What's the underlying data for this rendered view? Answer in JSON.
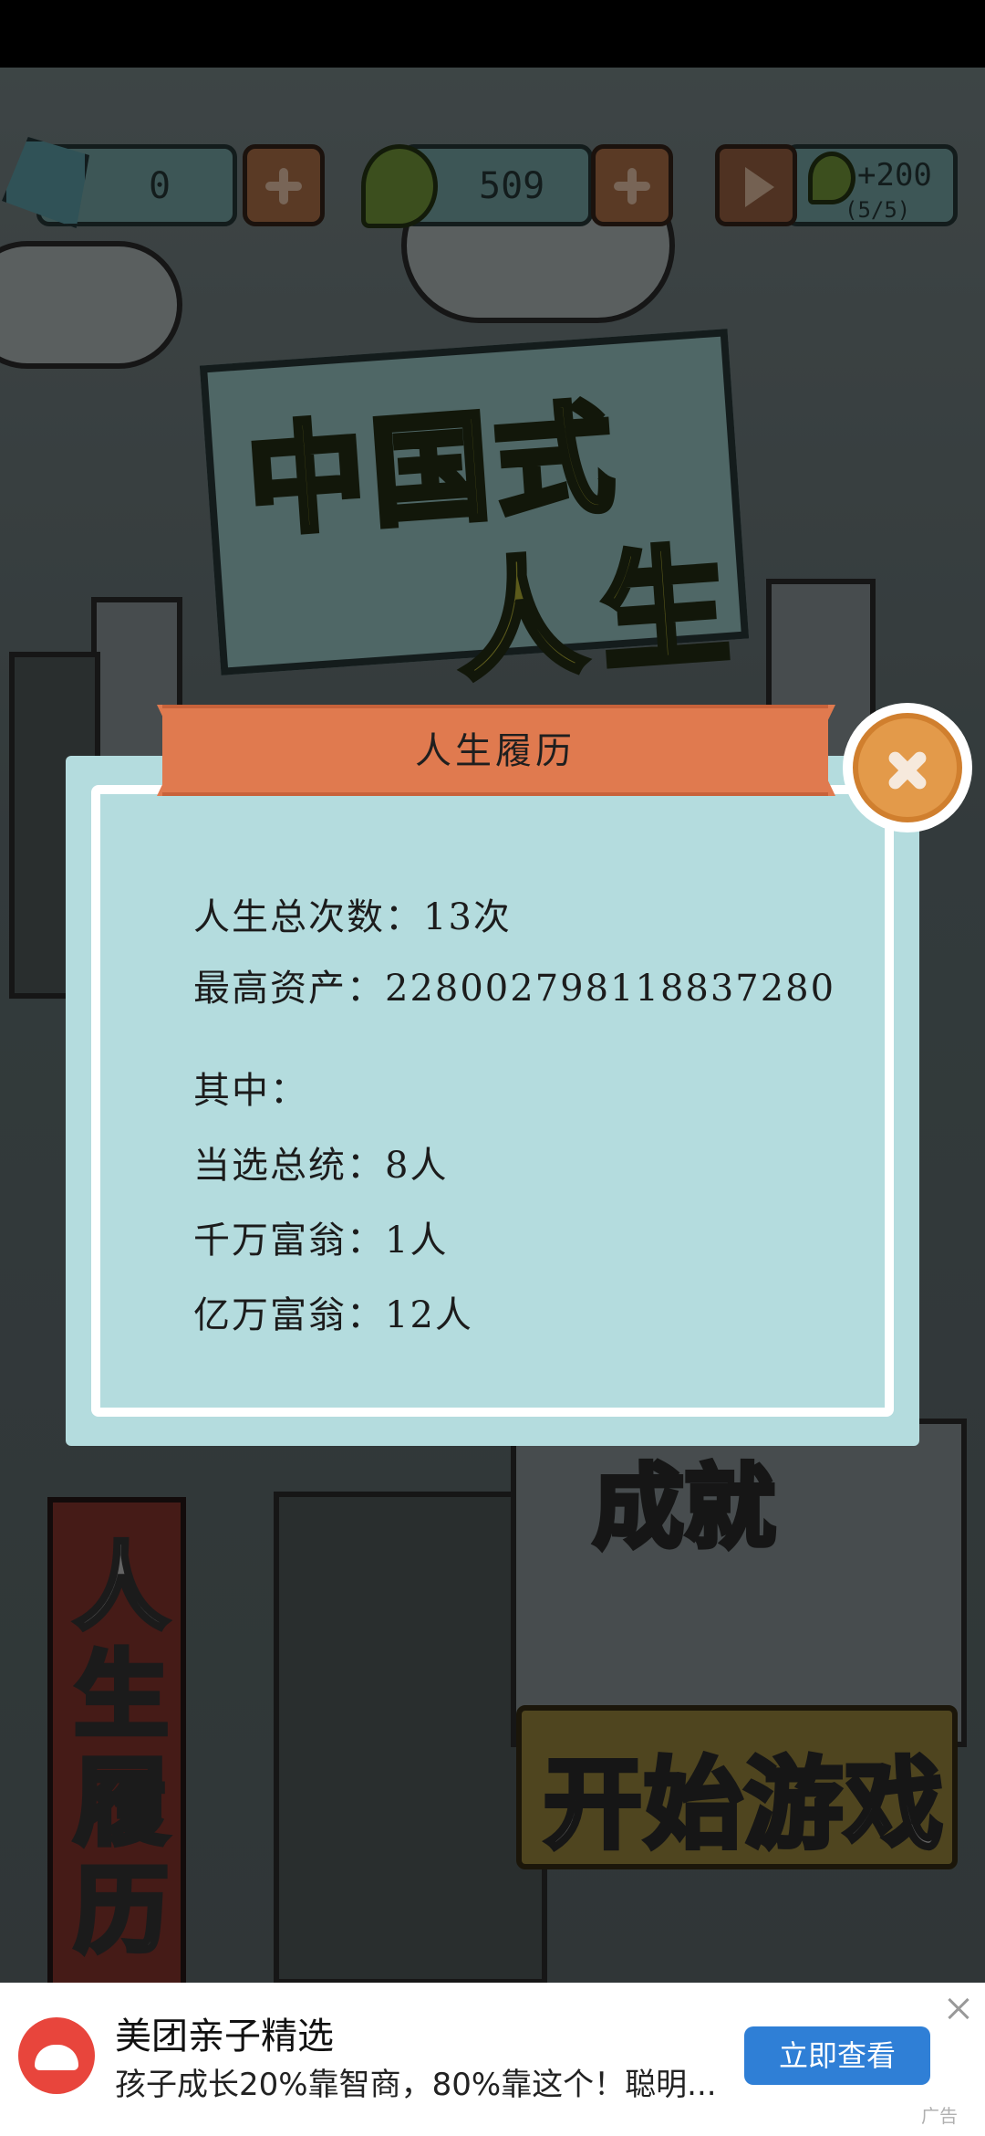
{
  "top_bar": {
    "gems_value": "0",
    "beans_value": "509",
    "reward_amount": "+200",
    "reward_count": "(5/5)"
  },
  "game_title": {
    "line1": "中国式",
    "line2": "人生"
  },
  "background_buttons": {
    "resume": "人生履历",
    "achievements": "成就",
    "start": "开始游戏"
  },
  "modal": {
    "title": "人生履历",
    "total_lives": "人生总次数：13次",
    "highest_assets": "最高资产：2280027981188372​80",
    "section_label": "其中：",
    "presidents": "当选总统：8人",
    "ten_millionaires": "千万富翁：1人",
    "billionaires": "亿万富翁：12人"
  },
  "ad": {
    "title": "美团亲子精选",
    "description": "孩子成长20%靠智商，80%靠这个！聪明...",
    "cta": "立即查看",
    "tag": "广告"
  },
  "colors": {
    "modal_bg": "#b4dcde",
    "ribbon": "#e07a4f",
    "close_button": "#e39a4a",
    "ad_button": "#2f7fd6"
  }
}
